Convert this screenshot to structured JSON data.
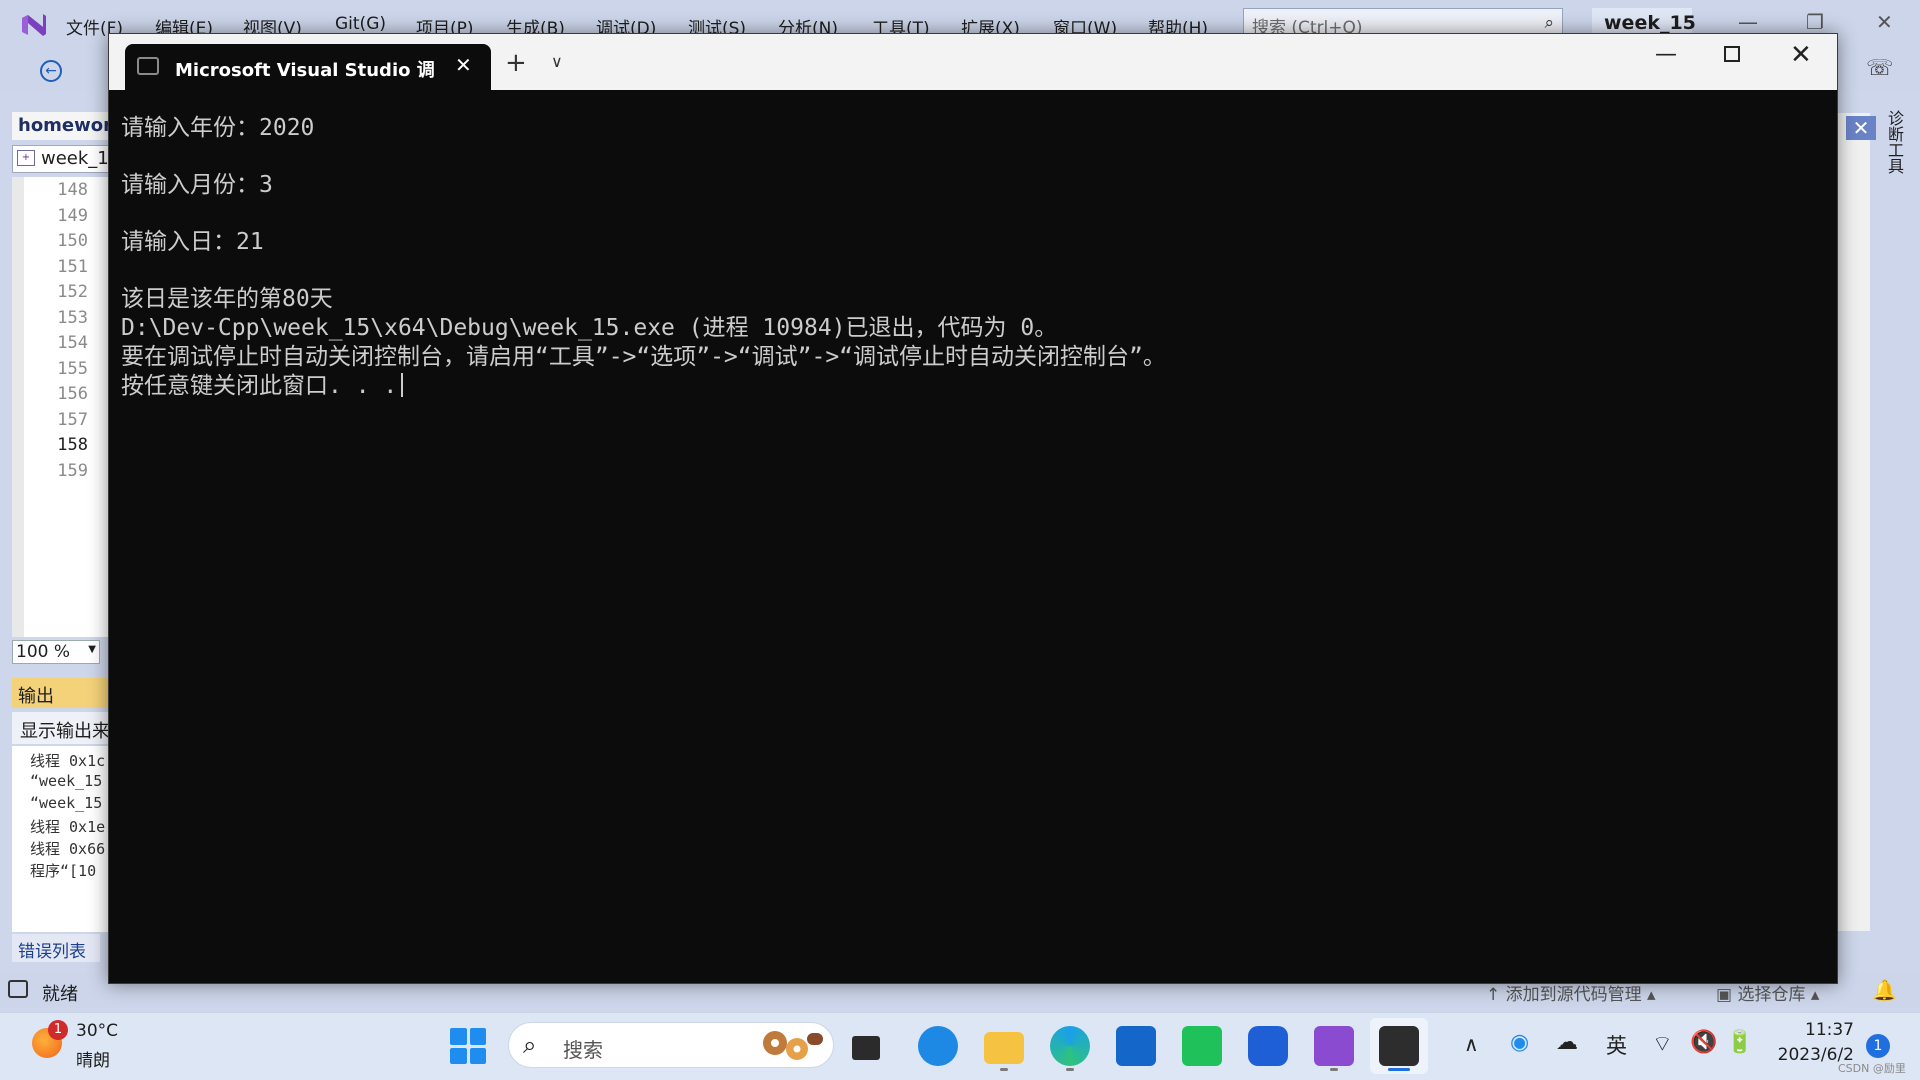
{
  "vs": {
    "menu": [
      "文件(F)",
      "编辑(E)",
      "视图(V)",
      "Git(G)",
      "项目(P)",
      "生成(B)",
      "调试(D)",
      "测试(S)",
      "分析(N)",
      "工具(T)",
      "扩展(X)",
      "窗口(W)",
      "帮助(H)"
    ],
    "search_placeholder": "搜索 (Ctrl+Q)",
    "project_name": "week_15",
    "doc_tab": "homework",
    "file_box": "week_1",
    "line_numbers": [
      "148",
      "149",
      "150",
      "151",
      "152",
      "153",
      "154",
      "155",
      "156",
      "157",
      "158",
      "159"
    ],
    "current_line": "158",
    "zoom": "100 %",
    "output_title": "输出",
    "output_source": "显示输出来",
    "output_lines": [
      "线程 0x1c",
      "“week_15",
      "“week_15",
      "线程 0x1e",
      "线程 0x66",
      "程序“[10"
    ],
    "error_tab": "错误列表",
    "diag_tab": "诊断工具",
    "status_text": "就绪",
    "status_scm": "添加到源代码管理",
    "status_repo": "选择仓库"
  },
  "console": {
    "tab_title": "Microsoft Visual Studio 调试控制台",
    "lines": [
      "请输入年份：2020",
      "请输入月份：3",
      "请输入日：21",
      "该日是该年的第80天",
      "D:\\Dev-Cpp\\week_15\\x64\\Debug\\week_15.exe (进程 10984)已退出，代码为 0。",
      "要在调试停止时自动关闭控制台，请启用“工具”->“选项”->“调试”->“调试停止时自动关闭控制台”。",
      "按任意键关闭此窗口. . ."
    ],
    "colors": {
      "background": "#0c0c0c",
      "text": "#cccccc"
    }
  },
  "taskbar": {
    "weather_temp": "30°C",
    "weather_desc": "晴朗",
    "weather_badge": "1",
    "search_placeholder": "搜索",
    "apps": [
      "file-manager",
      "edge-legacy",
      "file-explorer",
      "edge",
      "microsoft-store",
      "wechat",
      "lenovo-app",
      "visual-studio",
      "terminal"
    ],
    "tray_lang": "英",
    "time": "11:37",
    "date": "2023/6/2",
    "notification_count": "1",
    "watermark": "CSDN @励里"
  }
}
